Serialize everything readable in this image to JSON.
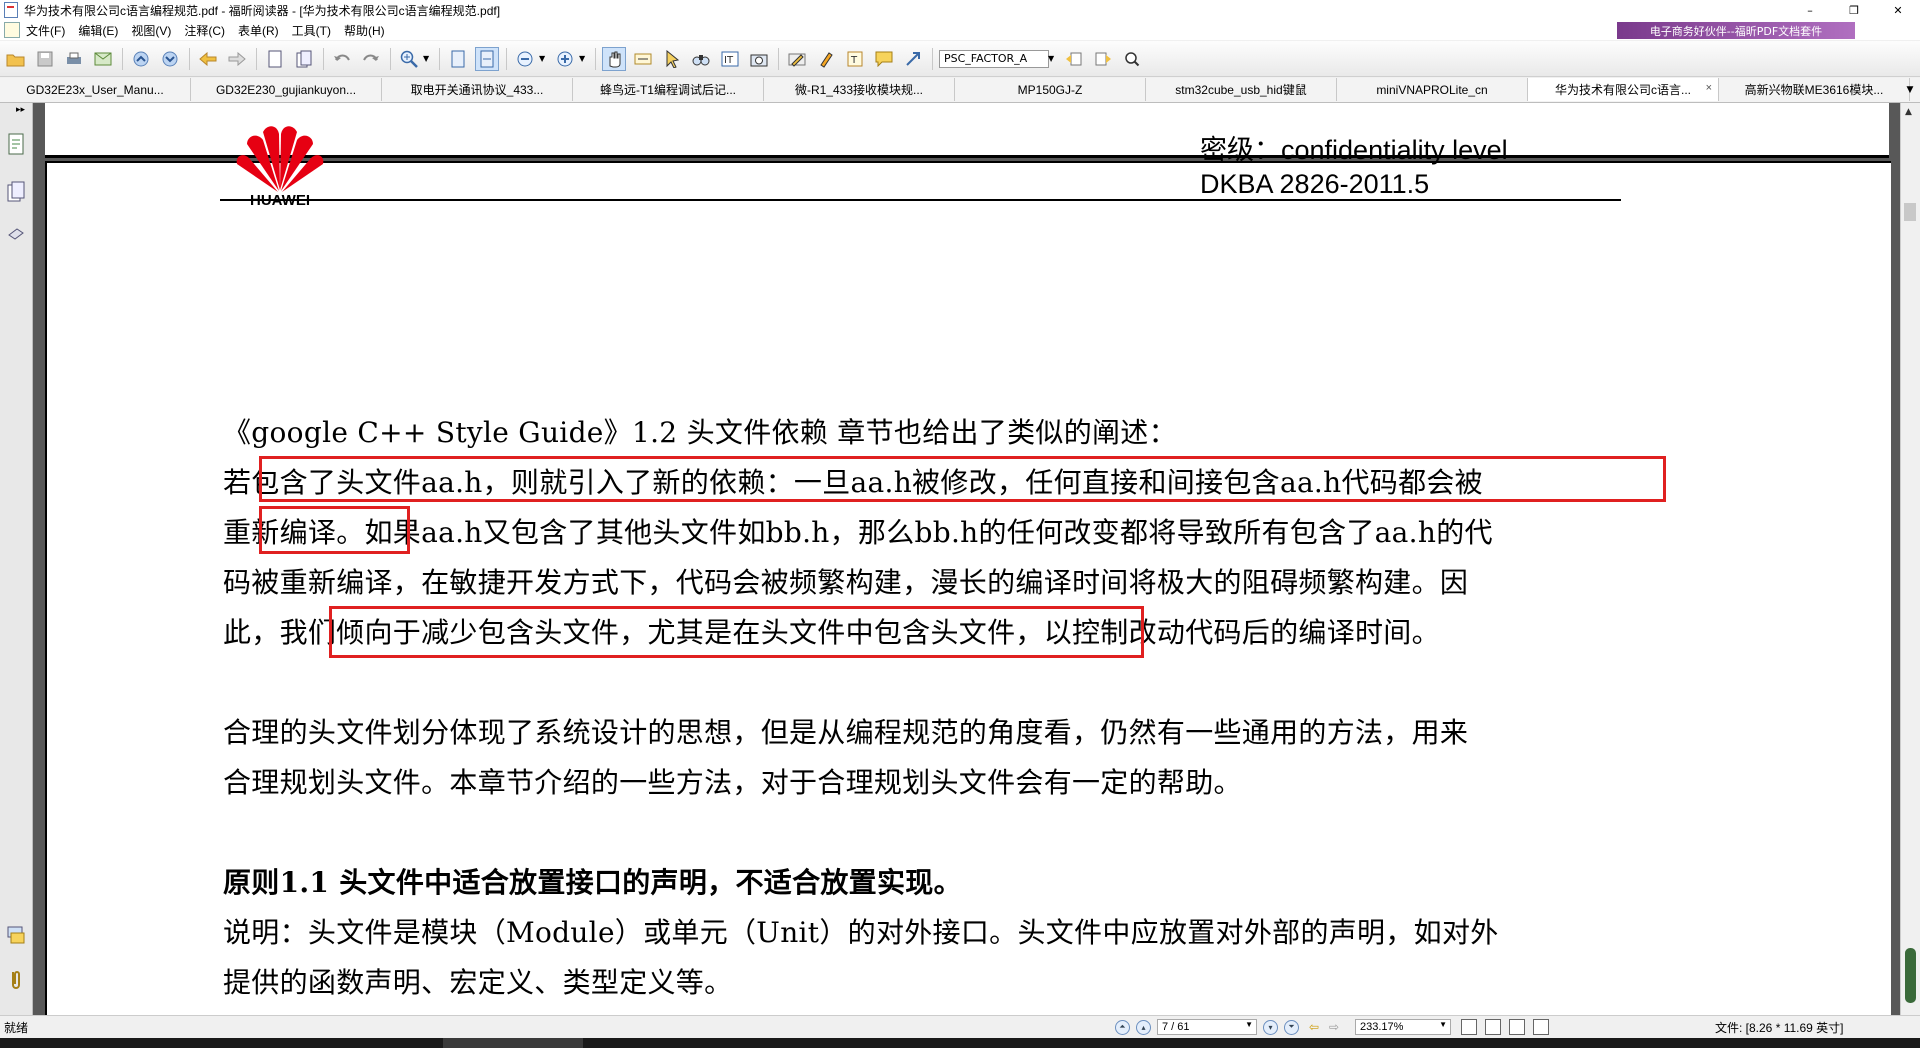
{
  "window": {
    "title": "华为技术有限公司c语言编程规范.pdf - 福昕阅读器 - [华为技术有限公司c语言编程规范.pdf]",
    "minimize": "–",
    "restore": "❐",
    "close": "✕"
  },
  "menu": {
    "items": [
      "文件(F)",
      "编辑(E)",
      "视图(V)",
      "注释(C)",
      "表单(R)",
      "工具(T)",
      "帮助(H)"
    ],
    "ad": "电子商务好伙伴--福昕PDF文档套件"
  },
  "toolbar": {
    "search_value": "PSC_FACTOR_A"
  },
  "tabs": [
    {
      "label": "GD32E23x_User_Manu..."
    },
    {
      "label": "GD32E230_gujiankuyon..."
    },
    {
      "label": "取电开关通讯协议_433..."
    },
    {
      "label": "蜂鸟远-T1编程调试后记..."
    },
    {
      "label": "微-R1_433接收模块规..."
    },
    {
      "label": "MP150GJ-Z"
    },
    {
      "label": "stm32cube_usb_hid键鼠"
    },
    {
      "label": "miniVNAPROLite_cn"
    },
    {
      "label": "华为技术有限公司c语言...",
      "active": true
    },
    {
      "label": "高新兴物联ME3616模块..."
    }
  ],
  "tab_close": "×",
  "document": {
    "logo_text": "HUAWEI",
    "conf_line1": "密级：confidentiality level",
    "conf_line2": "DKBA 2826-2011.5",
    "lines": [
      "《google C++ Style Guide》1.2 头文件依赖 章节也给出了类似的阐述：",
      "若包含了头文件aa.h，则就引入了新的依赖：一旦aa.h被修改，任何直接和间接包含aa.h代码都会被",
      "重新编译。如果aa.h又包含了其他头文件如bb.h，那么bb.h的任何改变都将导致所有包含了aa.h的代",
      "码被重新编译，在敏捷开发方式下，代码会被频繁构建，漫长的编译时间将极大的阻碍频繁构建。因",
      "此，我们倾向于减少包含头文件，尤其是在头文件中包含头文件，以控制改动代码后的编译时间。",
      "合理的头文件划分体现了系统设计的思想，但是从编程规范的角度看，仍然有一些通用的方法，用来",
      "合理规划头文件。本章节介绍的一些方法，对于合理规划头文件会有一定的帮助。",
      "原则1.1 头文件中适合放置接口的声明，不适合放置实现。",
      "说明：头文件是模块（Module）或单元（Unit）的对外接口。头文件中应放置对外部的声明，如对外",
      "提供的函数声明、宏定义、类型定义等。"
    ]
  },
  "status": {
    "left": "就绪",
    "page": "7 / 61",
    "zoom": "233.17%",
    "file_size": "文件: [8.26 * 11.69 英寸]"
  }
}
